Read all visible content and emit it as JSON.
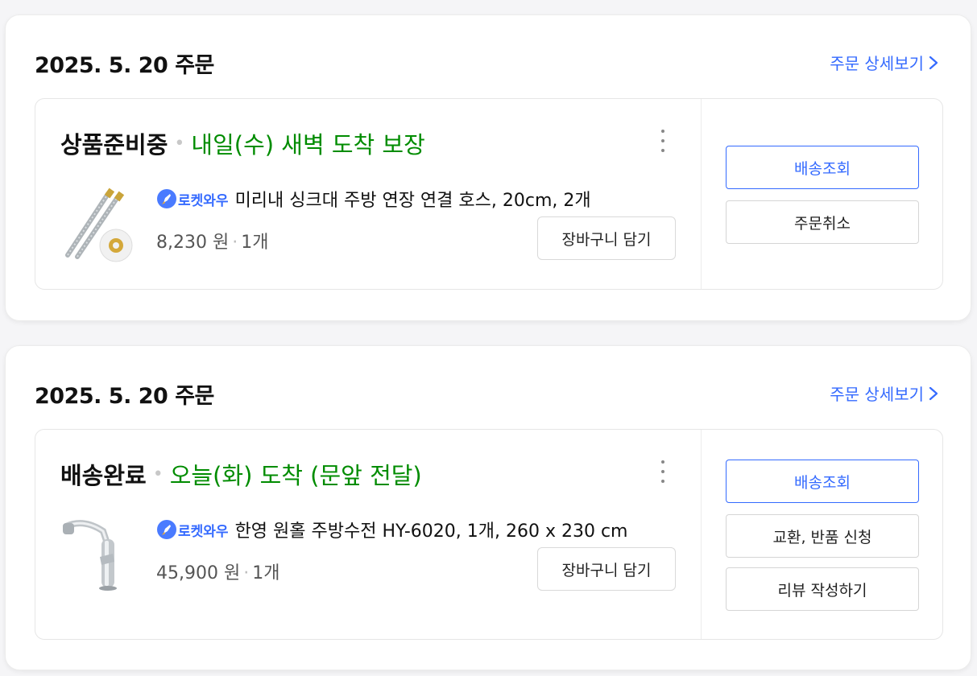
{
  "orders": [
    {
      "date": "2025. 5. 20 주문",
      "detail_link": "주문 상세보기",
      "status": "상품준비중",
      "status_sep": "•",
      "eta": "내일(수) 새벽 도착 보장",
      "badge": "로켓와우",
      "product_name": "미리내 싱크대 주방 연장 연결 호스, 20cm, 2개",
      "price": "8,230 원",
      "price_sep": "·",
      "qty": "1개",
      "cart_button": "장바구니 담기",
      "actions": [
        "배송조회",
        "주문취소"
      ],
      "thumb_icon": "hose-product-image"
    },
    {
      "date": "2025. 5. 20 주문",
      "detail_link": "주문 상세보기",
      "status": "배송완료",
      "status_sep": "•",
      "eta": "오늘(화) 도착 (문앞 전달)",
      "badge": "로켓와우",
      "product_name": "한영 원홀 주방수전 HY-6020, 1개, 260 x 230 cm",
      "price": "45,900 원",
      "price_sep": "·",
      "qty": "1개",
      "cart_button": "장바구니 담기",
      "actions": [
        "배송조회",
        "교환, 반품 신청",
        "리뷰 작성하기"
      ],
      "thumb_icon": "faucet-product-image"
    }
  ],
  "colors": {
    "accent": "#346aff",
    "eta_green": "#008c00",
    "text": "#111111"
  }
}
